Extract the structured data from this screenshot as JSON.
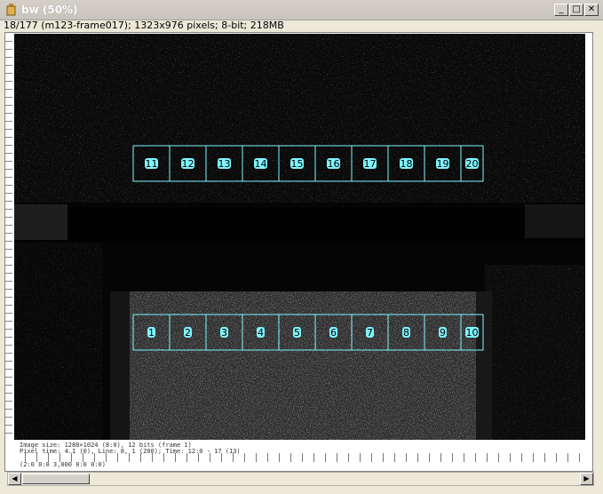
{
  "window": {
    "title": "bw (50%)",
    "minimize_label": "_",
    "maximize_label": "□",
    "close_label": "✕"
  },
  "info_line": "18/177 (m123-frame017); 1323x976 pixels; 8-bit; 218MB",
  "rois_top": [
    "11",
    "12",
    "13",
    "14",
    "15",
    "16",
    "17",
    "18",
    "19",
    "20"
  ],
  "rois_bottom": [
    "1",
    "2",
    "3",
    "4",
    "5",
    "6",
    "7",
    "8",
    "9",
    "10"
  ],
  "bottom_text": {
    "line1": "Image size: 1280×1024 (8:0), 12 bits (frame 1)",
    "line2": "Pixel time: 4.1 (0), Line: 8, 1 (200); Time: 12:0 - 17 (13)",
    "line3": "(2:0 0:0 3,000 0:0 0:0)"
  },
  "colors": {
    "roi": "#7ff5ff",
    "image_bg": "#050505"
  },
  "icons": {
    "title": "imagej-window-icon",
    "scroll_left": "triangle-left",
    "scroll_right": "triangle-right"
  }
}
